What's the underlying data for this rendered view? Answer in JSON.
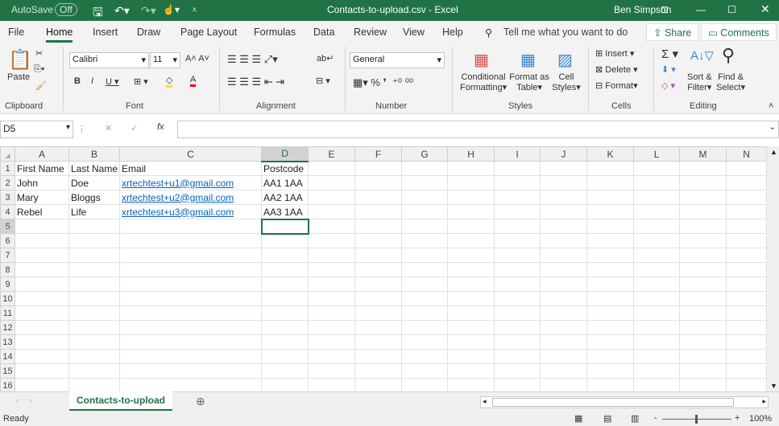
{
  "title": {
    "autosave": "AutoSave",
    "autosave_state": "Off",
    "doc": "Contacts-to-upload.csv  -  Excel",
    "user": "Ben Simpson"
  },
  "tabs": [
    "File",
    "Home",
    "Insert",
    "Draw",
    "Page Layout",
    "Formulas",
    "Data",
    "Review",
    "View",
    "Help"
  ],
  "tell_me": "Tell me what you want to do",
  "share": "Share",
  "comments": "Comments",
  "ribbon": {
    "paste": "Paste",
    "font_name": "Calibri",
    "font_size": "11",
    "number_format": "General",
    "conditional": [
      "Conditional",
      "Formatting"
    ],
    "format_table": [
      "Format as",
      "Table"
    ],
    "cell_styles": [
      "Cell",
      "Styles"
    ],
    "insert": "Insert",
    "delete": "Delete",
    "format": "Format",
    "sort": [
      "Sort &",
      "Filter"
    ],
    "find": [
      "Find &",
      "Select"
    ],
    "groups": [
      "Clipboard",
      "Font",
      "Alignment",
      "Number",
      "Styles",
      "Cells",
      "Editing"
    ]
  },
  "name_box": "D5",
  "formula": "",
  "columns": [
    "A",
    "B",
    "C",
    "D",
    "E",
    "F",
    "G",
    "H",
    "I",
    "J",
    "K",
    "L",
    "M",
    "N"
  ],
  "rows": [
    [
      "First Name",
      "Last Name",
      "Email",
      "Postcode"
    ],
    [
      "John",
      "Doe",
      "xrtechtest+u1@gmail.com",
      "AA1 1AA"
    ],
    [
      "Mary",
      "Bloggs",
      "xrtechtest+u2@gmail.com",
      "AA2 1AA"
    ],
    [
      "Rebel",
      "Life",
      "xrtechtest+u3@gmail.com",
      "AA3 1AA"
    ]
  ],
  "row_count": 16,
  "selected_cell": "D5",
  "sheet_tab": "Contacts-to-upload",
  "status": "Ready",
  "zoom": "100%",
  "accent": "#217346"
}
